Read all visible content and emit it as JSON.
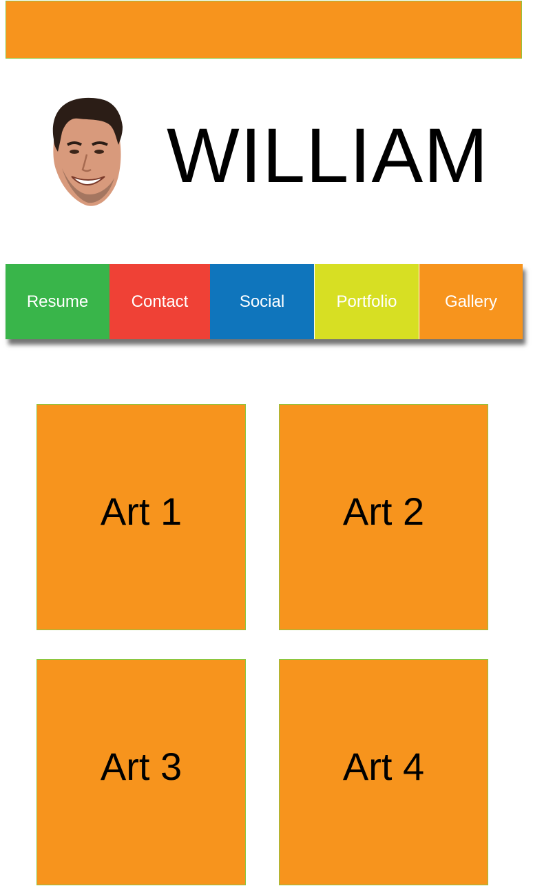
{
  "header": {
    "name": "WILLIAM"
  },
  "colors": {
    "accent_orange": "#f7941d",
    "tile_border_green": "#8dc63f",
    "resume": "#39b54a",
    "contact": "#ef4136",
    "social": "#0f75bc",
    "portfolio": "#d7df23",
    "gallery": "#f7941d"
  },
  "nav": {
    "items": [
      {
        "label": "Resume",
        "color": "#39b54a"
      },
      {
        "label": "Contact",
        "color": "#ef4136"
      },
      {
        "label": "Social",
        "color": "#0f75bc"
      },
      {
        "label": "Portfolio",
        "color": "#d7df23"
      },
      {
        "label": "Gallery",
        "color": "#f7941d"
      }
    ]
  },
  "gallery": {
    "tiles": [
      {
        "label": "Art 1"
      },
      {
        "label": "Art 2"
      },
      {
        "label": "Art 3"
      },
      {
        "label": "Art 4"
      }
    ]
  }
}
